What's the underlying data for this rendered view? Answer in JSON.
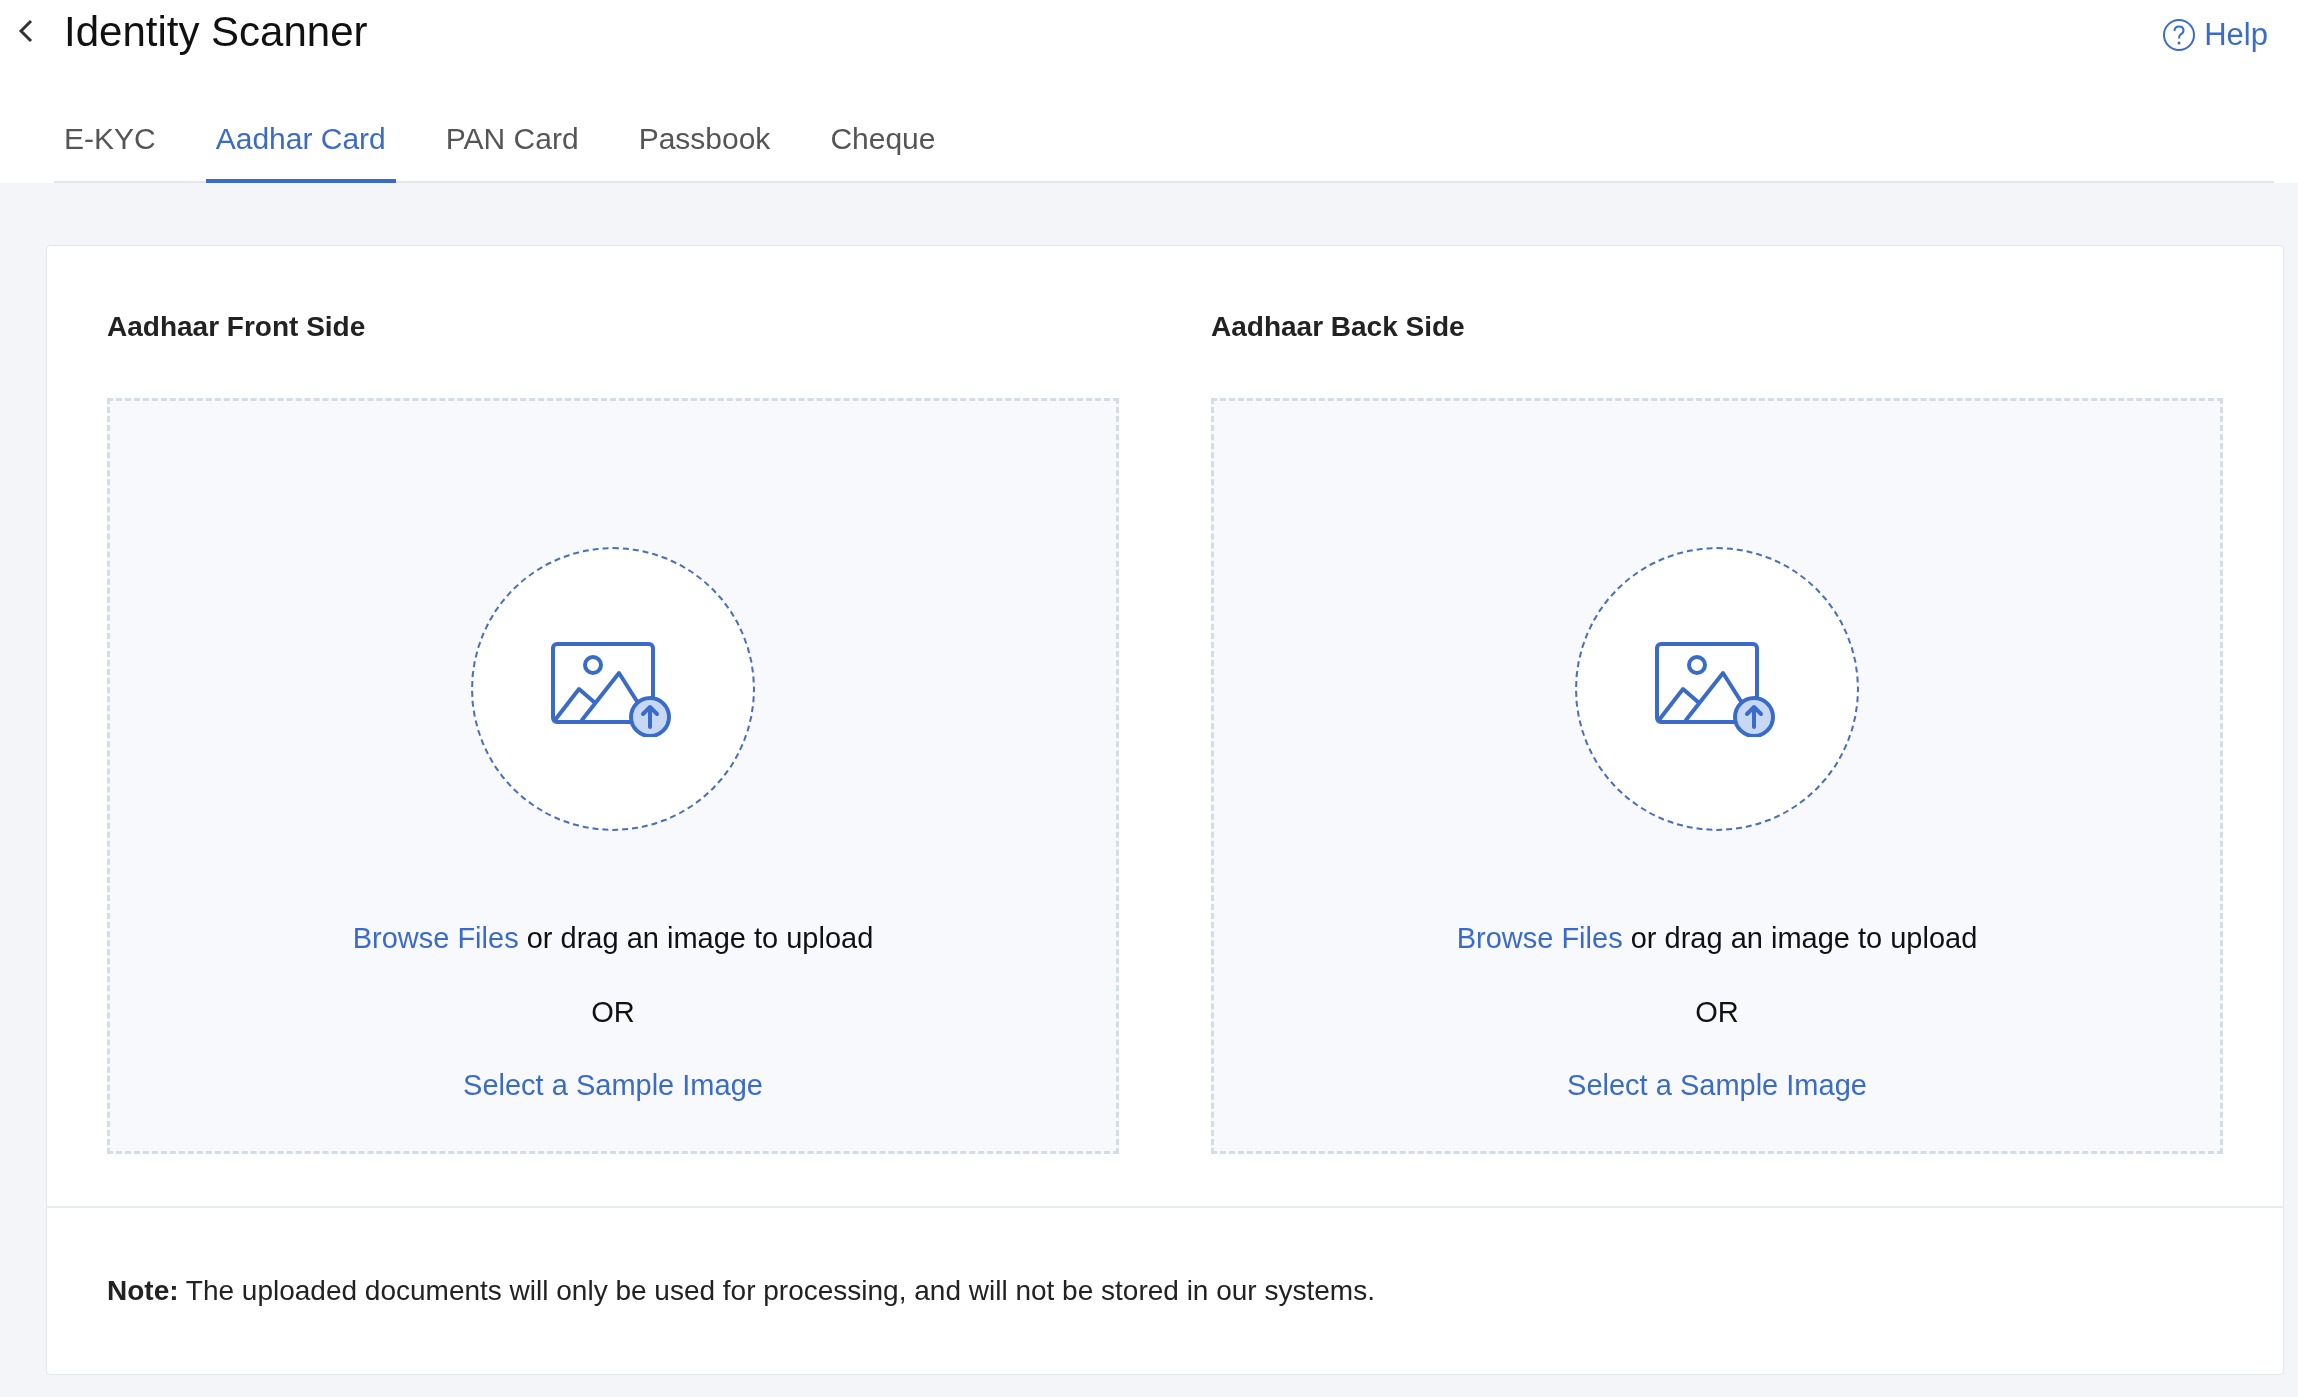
{
  "header": {
    "title": "Identity Scanner",
    "help": "Help"
  },
  "tabs": [
    {
      "label": "E-KYC",
      "selected": false
    },
    {
      "label": "Aadhar Card",
      "selected": true
    },
    {
      "label": "PAN Card",
      "selected": false
    },
    {
      "label": "Passbook",
      "selected": false
    },
    {
      "label": "Cheque",
      "selected": false
    }
  ],
  "uploads": [
    {
      "heading": "Aadhaar Front Side",
      "browse_link": "Browse Files",
      "instruction": "or drag an image to upload",
      "separator": "OR",
      "sample_link": "Select a Sample Image"
    },
    {
      "heading": "Aadhaar Back Side",
      "browse_link": "Browse Files",
      "instruction": "or drag an image to upload",
      "separator": "OR",
      "sample_link": "Select a Sample Image"
    }
  ],
  "note": "**Note:** The uploaded documents will only be used for processing, and will not be stored in our systems."
}
